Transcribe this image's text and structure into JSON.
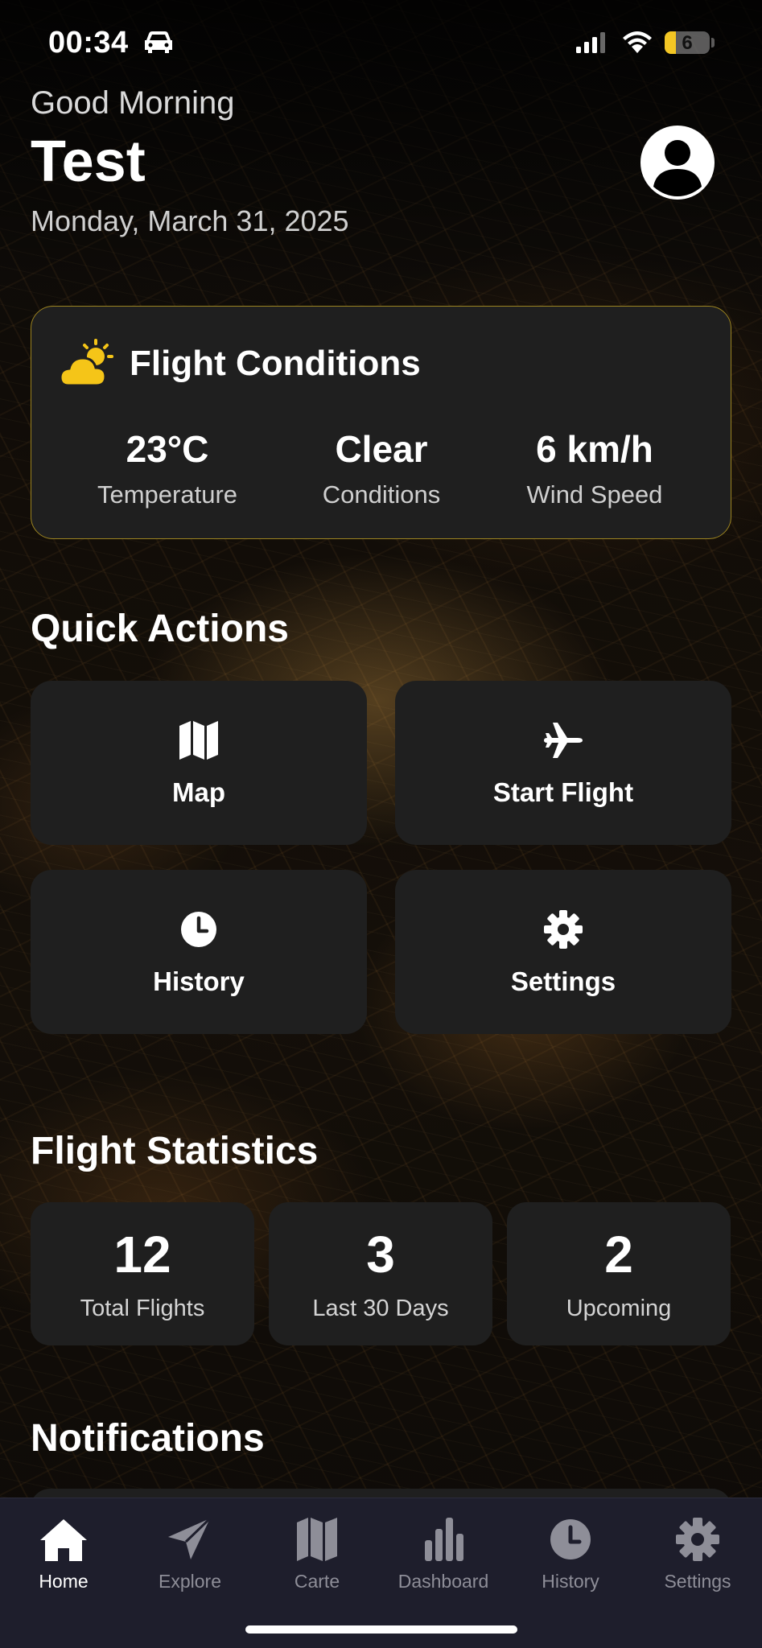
{
  "status_bar": {
    "time": "00:34",
    "battery_level": "6",
    "battery_color": "#f3c624"
  },
  "header": {
    "greeting": "Good Morning",
    "user_name": "Test",
    "date": "Monday, March 31, 2025",
    "avatar_icon": "user-circle-icon"
  },
  "conditions": {
    "title": "Flight Conditions",
    "icon": "partly-sunny-icon",
    "accent_color": "#f5c518",
    "items": [
      {
        "value": "23°C",
        "label": "Temperature"
      },
      {
        "value": "Clear",
        "label": "Conditions"
      },
      {
        "value": "6 km/h",
        "label": "Wind Speed"
      }
    ]
  },
  "quick_actions": {
    "title": "Quick Actions",
    "items": [
      {
        "label": "Map",
        "icon": "map-icon"
      },
      {
        "label": "Start Flight",
        "icon": "airplane-icon"
      },
      {
        "label": "History",
        "icon": "clock-icon"
      },
      {
        "label": "Settings",
        "icon": "gear-icon"
      }
    ]
  },
  "statistics": {
    "title": "Flight Statistics",
    "items": [
      {
        "value": "12",
        "label": "Total Flights"
      },
      {
        "value": "3",
        "label": "Last 30 Days"
      },
      {
        "value": "2",
        "label": "Upcoming"
      }
    ]
  },
  "notifications": {
    "title": "Notifications"
  },
  "tab_bar": {
    "active_color": "#ffffff",
    "inactive_color": "#8e8e98",
    "tabs": [
      {
        "label": "Home",
        "icon": "home-icon",
        "active": true
      },
      {
        "label": "Explore",
        "icon": "paper-plane-icon",
        "active": false
      },
      {
        "label": "Carte",
        "icon": "map-icon",
        "active": false
      },
      {
        "label": "Dashboard",
        "icon": "bar-chart-icon",
        "active": false
      },
      {
        "label": "History",
        "icon": "clock-icon",
        "active": false
      },
      {
        "label": "Settings",
        "icon": "gear-icon",
        "active": false
      }
    ]
  }
}
